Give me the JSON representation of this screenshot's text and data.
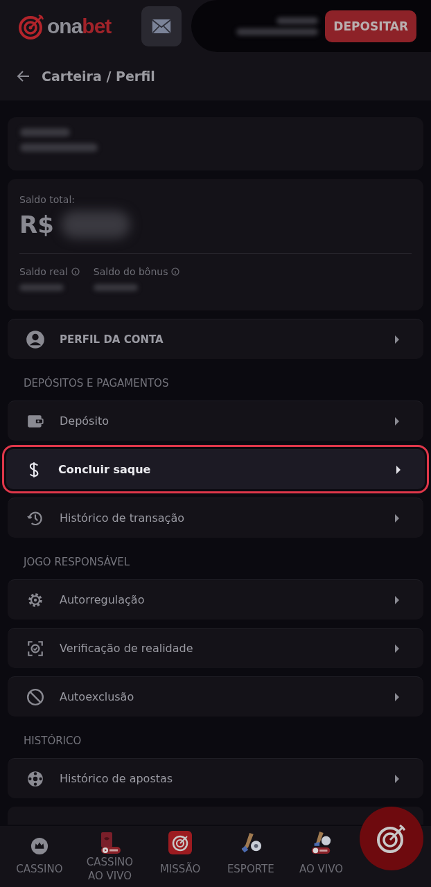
{
  "header": {
    "logo": {
      "part_1": "ona",
      "part_2": "bet"
    },
    "deposit_button": "DEPOSITAR"
  },
  "breadcrumb": "Carteira / Perfil",
  "balance": {
    "label": "Saldo total:",
    "currency": "R$",
    "real_label": "Saldo real",
    "bonus_label": "Saldo do bônus"
  },
  "sections": [
    {
      "items": [
        {
          "label": "PERFIL DA CONTA",
          "selected": false
        }
      ]
    },
    {
      "title": "DEPÓSITOS E PAGAMENTOS",
      "items": [
        {
          "label": "Depósito",
          "selected": false
        },
        {
          "label": "Concluir saque",
          "selected": true
        },
        {
          "label": "Histórico de transação",
          "selected": false
        }
      ]
    },
    {
      "title": "JOGO RESPONSÁVEL",
      "items": [
        {
          "label": "Autorregulação",
          "selected": false
        },
        {
          "label": "Verificação de realidade",
          "selected": false
        },
        {
          "label": "Autoexclusão",
          "selected": false
        }
      ]
    },
    {
      "title": "HISTÓRICO",
      "items": [
        {
          "label": "Histórico de apostas",
          "selected": false
        }
      ]
    }
  ],
  "bottom_nav": [
    {
      "label": "CASSINO"
    },
    {
      "label": "CASSINO AO VIVO"
    },
    {
      "label": "MISSÃO"
    },
    {
      "label": "ESPORTE"
    },
    {
      "label": "AO VIVO"
    }
  ]
}
